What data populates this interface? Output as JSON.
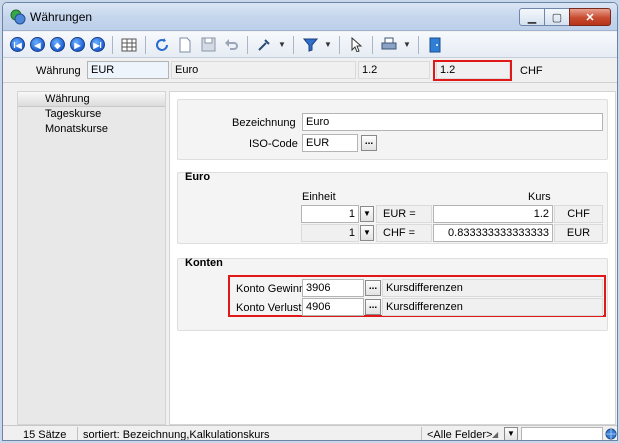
{
  "window": {
    "title": "Währungen",
    "colors": {
      "accent": "#1c5fd1",
      "highlight": "#e01818"
    }
  },
  "toolbar": {
    "nav": [
      {
        "name": "first-record-icon",
        "glyph": "|◀"
      },
      {
        "name": "prev-page-icon",
        "glyph": "◀◀"
      },
      {
        "name": "prev-record-icon",
        "glyph": "◀▶"
      },
      {
        "name": "next-record-icon",
        "glyph": "▶"
      },
      {
        "name": "last-record-icon",
        "glyph": "▶|"
      }
    ]
  },
  "header": {
    "currency_label": "Währung",
    "currency_code": "EUR",
    "currency_name": "Euro",
    "rate": "1.2",
    "calc_rate": "1.2",
    "foreign_code": "CHF"
  },
  "sidebar": {
    "items": [
      {
        "label": "Währung",
        "active": true
      },
      {
        "label": "Tageskurse",
        "active": false
      },
      {
        "label": "Monatskurse",
        "active": false
      }
    ]
  },
  "general": {
    "bezeichnung_label": "Bezeichnung",
    "bezeichnung_value": "Euro",
    "iso_label": "ISO-Code",
    "iso_value": "EUR",
    "lookup_glyph": "..."
  },
  "euro_panel": {
    "title": "Euro",
    "col_einheit": "Einheit",
    "col_kurs": "Kurs",
    "rows": [
      {
        "units": "1",
        "pair": "EUR =",
        "rate": "1.2",
        "currency": "CHF"
      },
      {
        "units": "1",
        "pair": "CHF =",
        "rate": "0.833333333333333",
        "currency": "EUR"
      }
    ]
  },
  "konten_panel": {
    "title": "Konten",
    "rows": [
      {
        "label": "Konto Gewinn",
        "account": "3906",
        "description": "Kursdifferenzen"
      },
      {
        "label": "Konto Verlust",
        "account": "4906",
        "description": "Kursdifferenzen"
      }
    ]
  },
  "status": {
    "count": "15 Sätze",
    "sorted": "sortiert: Bezeichnung,Kalkulationskurs",
    "filter": "<Alle Felder>"
  }
}
